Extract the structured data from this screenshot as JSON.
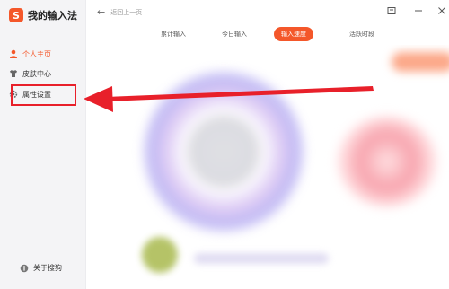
{
  "app": {
    "logo_glyph": "S",
    "title": "我的输入法",
    "brand_color": "#f4572a"
  },
  "sidebar": {
    "items": [
      {
        "label": "个人主页",
        "icon": "person-icon",
        "active": true
      },
      {
        "label": "皮肤中心",
        "icon": "shirt-icon",
        "active": false
      },
      {
        "label": "属性设置",
        "icon": "gear-icon",
        "active": false
      }
    ],
    "footer": {
      "label": "关于搜狗",
      "icon": "info-icon"
    }
  },
  "topbar": {
    "back_label": "返回上一页",
    "back_icon": "arrow-left-icon"
  },
  "tabs": [
    {
      "label": "累计输入",
      "active": false
    },
    {
      "label": "今日输入",
      "active": false
    },
    {
      "label": "输入速度",
      "active": true
    },
    {
      "label": "活跃时段",
      "active": false
    }
  ],
  "annotation": {
    "color": "#e8202a"
  }
}
